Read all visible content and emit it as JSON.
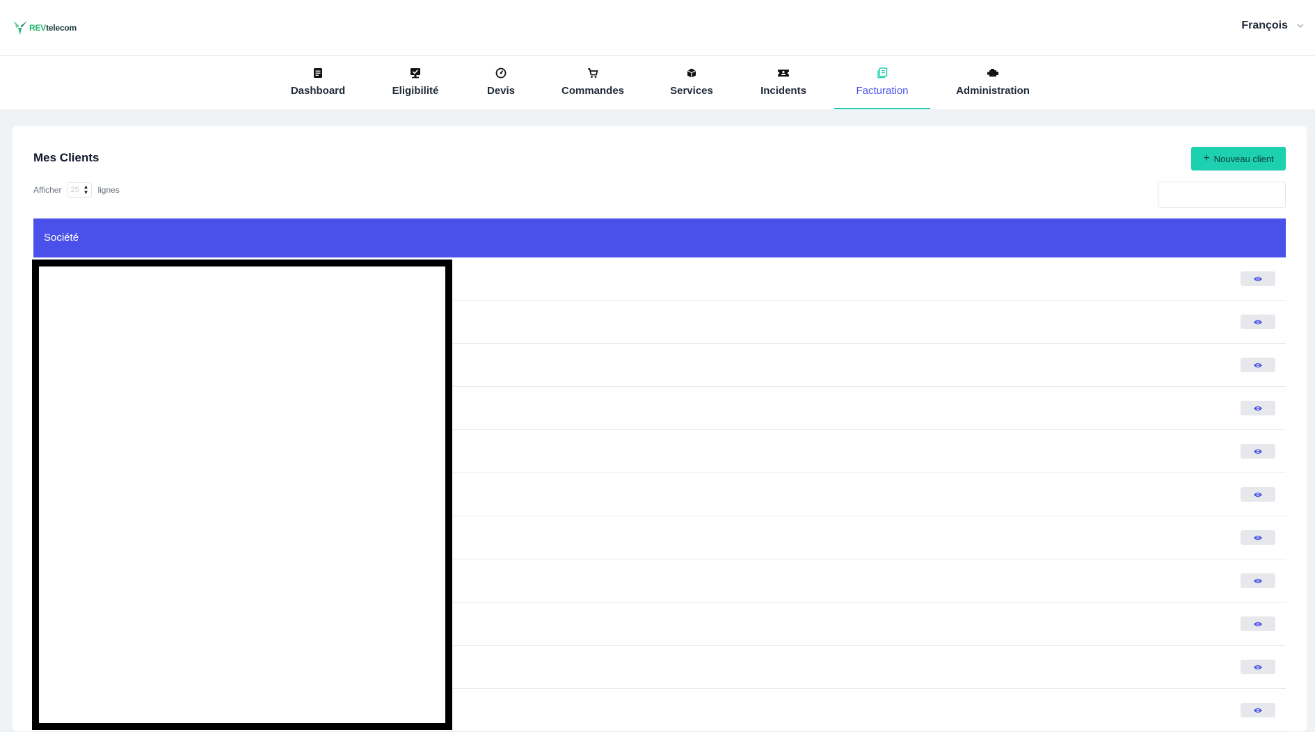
{
  "header": {
    "logo_prefix": "REV",
    "logo_suffix": "telecom",
    "user_name": "François"
  },
  "nav": {
    "items": [
      {
        "label": "Dashboard",
        "icon": "document-list-icon"
      },
      {
        "label": "Eligibilité",
        "icon": "monitor-check-icon"
      },
      {
        "label": "Devis",
        "icon": "gauge-icon"
      },
      {
        "label": "Commandes",
        "icon": "cart-icon"
      },
      {
        "label": "Services",
        "icon": "box-icon"
      },
      {
        "label": "Incidents",
        "icon": "ticket-icon"
      },
      {
        "label": "Facturation",
        "icon": "invoice-icon",
        "active": true
      },
      {
        "label": "Administration",
        "icon": "engine-icon"
      }
    ]
  },
  "page": {
    "title": "Mes Clients",
    "new_button_label": "Nouveau client",
    "show_prefix": "Afficher",
    "show_value": "25",
    "show_suffix": "lignes",
    "search_value": ""
  },
  "table": {
    "columns": [
      "Société"
    ],
    "rows": [
      {
        "societe": ""
      },
      {
        "societe": ""
      },
      {
        "societe": ""
      },
      {
        "societe": ""
      },
      {
        "societe": ""
      },
      {
        "societe": ""
      },
      {
        "societe": ""
      },
      {
        "societe": ""
      },
      {
        "societe": ""
      },
      {
        "societe": ""
      },
      {
        "societe": ""
      }
    ]
  },
  "colors": {
    "accent_teal": "#1dd0b0",
    "primary_blue": "#4a50ea",
    "background": "#eff3f6"
  }
}
